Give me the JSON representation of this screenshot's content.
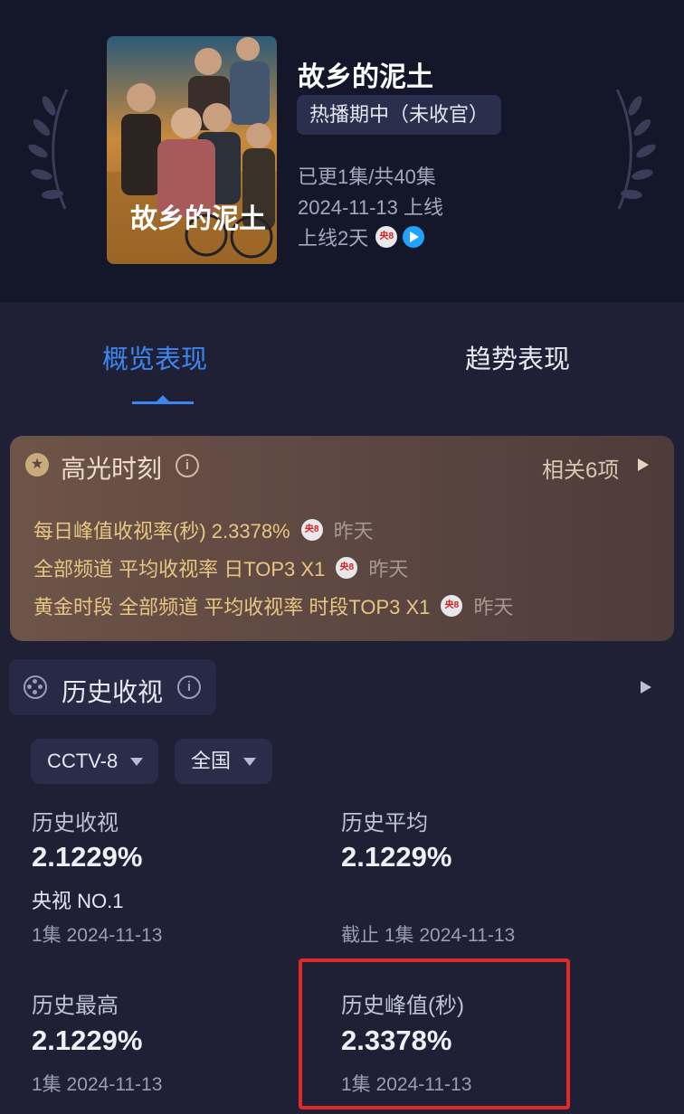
{
  "show": {
    "title": "故乡的泥土",
    "status": "热播期中（未收官）",
    "episodes": "已更1集/共40集",
    "release": "2024-11-13 上线",
    "days_online": "上线2天",
    "channel_logo": "央8",
    "poster_text": "故乡的泥土"
  },
  "tabs": {
    "overview": "概览表现",
    "trend": "趋势表现"
  },
  "highlights": {
    "title": "高光时刻",
    "related": "相关6项",
    "rows": [
      {
        "text": "每日峰值收视率(秒)  2.3378%",
        "logo": "央8",
        "when": "昨天"
      },
      {
        "text": "全部频道 平均收视率  日TOP3 X1",
        "logo": "央8",
        "when": "昨天"
      },
      {
        "text": "黄金时段 全部频道 平均收视率  时段TOP3 X1",
        "logo": "央8",
        "when": "昨天"
      }
    ]
  },
  "history": {
    "title": "历史收视",
    "filters": {
      "channel": "CCTV-8",
      "region": "全国"
    },
    "stats": {
      "history_rating": {
        "label": "历史收视",
        "value": "2.1229%",
        "rank": "央视 NO.1",
        "sub": "1集 2024-11-13"
      },
      "history_avg": {
        "label": "历史平均",
        "value": "2.1229%",
        "sub": "截止 1集 2024-11-13"
      },
      "history_max": {
        "label": "历史最高",
        "value": "2.1229%",
        "sub": "1集 2024-11-13"
      },
      "history_peak": {
        "label": "历史峰值(秒)",
        "value": "2.3378%",
        "sub": "1集 2024-11-13"
      }
    }
  },
  "colors": {
    "accent": "#3d86f0",
    "highlight_gold": "#e7c684",
    "annotation_red": "#e02a2a"
  }
}
